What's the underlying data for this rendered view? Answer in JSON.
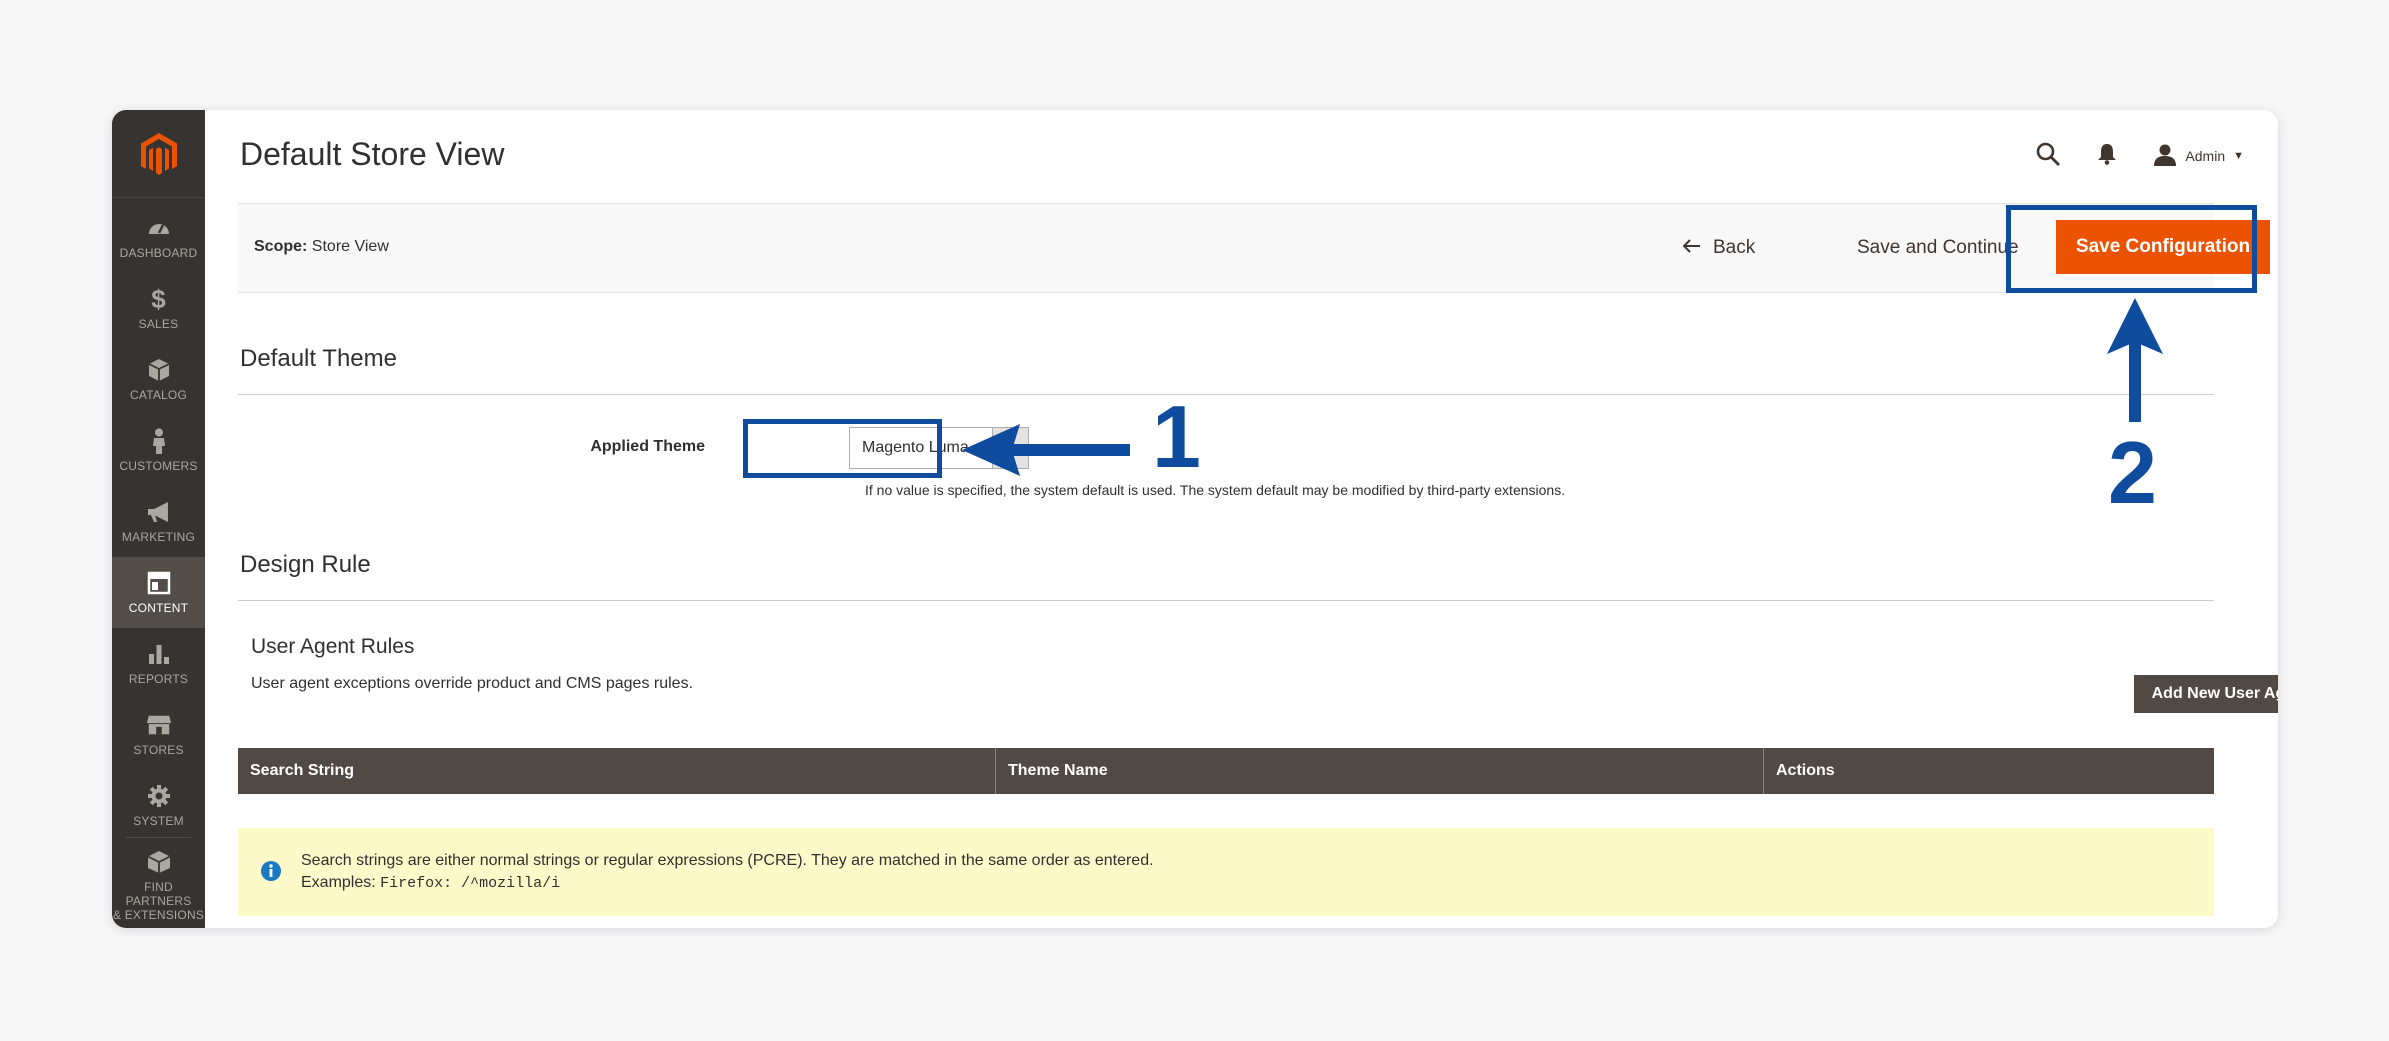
{
  "sidebar": {
    "logo_icon": "magento-logo-icon",
    "items": [
      {
        "label": "DASHBOARD",
        "icon": "dashboard-icon"
      },
      {
        "label": "SALES",
        "icon": "dollar-icon"
      },
      {
        "label": "CATALOG",
        "icon": "cube-icon"
      },
      {
        "label": "CUSTOMERS",
        "icon": "person-icon"
      },
      {
        "label": "MARKETING",
        "icon": "megaphone-icon"
      },
      {
        "label": "CONTENT",
        "icon": "layout-icon",
        "active": true
      },
      {
        "label": "REPORTS",
        "icon": "bar-chart-icon"
      },
      {
        "label": "STORES",
        "icon": "storefront-icon"
      },
      {
        "label": "SYSTEM",
        "icon": "gear-icon"
      },
      {
        "label": "FIND PARTNERS",
        "label2": "& EXTENSIONS",
        "icon": "box-icon"
      }
    ]
  },
  "header": {
    "title": "Default Store View",
    "user": "Admin"
  },
  "page_actions": {
    "scope_label": "Scope:",
    "scope_value": "Store View",
    "back": "Back",
    "save_continue": "Save and Continue",
    "save_config": "Save Configuration"
  },
  "default_theme": {
    "title": "Default Theme",
    "label": "Applied Theme",
    "value": "Magento Luma",
    "note": "If no value is specified, the system default is used. The system default may be modified by third-party extensions."
  },
  "annotations": {
    "step1": "1",
    "step2": "2",
    "color": "#0f4c9e"
  },
  "design_rule": {
    "title": "Design Rule",
    "sub_title": "User Agent Rules",
    "sub_desc": "User agent exceptions override product and CMS pages rules.",
    "add_button": "Add New User Agent Rule",
    "columns": [
      "Search String",
      "Theme Name",
      "Actions"
    ],
    "message_line1": "Search strings are either normal strings or regular expressions (PCRE). They are matched in the same order as entered.",
    "message_prefix": "Examples: ",
    "message_code": "Firefox: /^mozilla/i"
  },
  "colors": {
    "accent": "#eb5202",
    "sidebar_bg": "#373330",
    "grid_header": "#514943",
    "message_bg": "#fdf9c8"
  }
}
